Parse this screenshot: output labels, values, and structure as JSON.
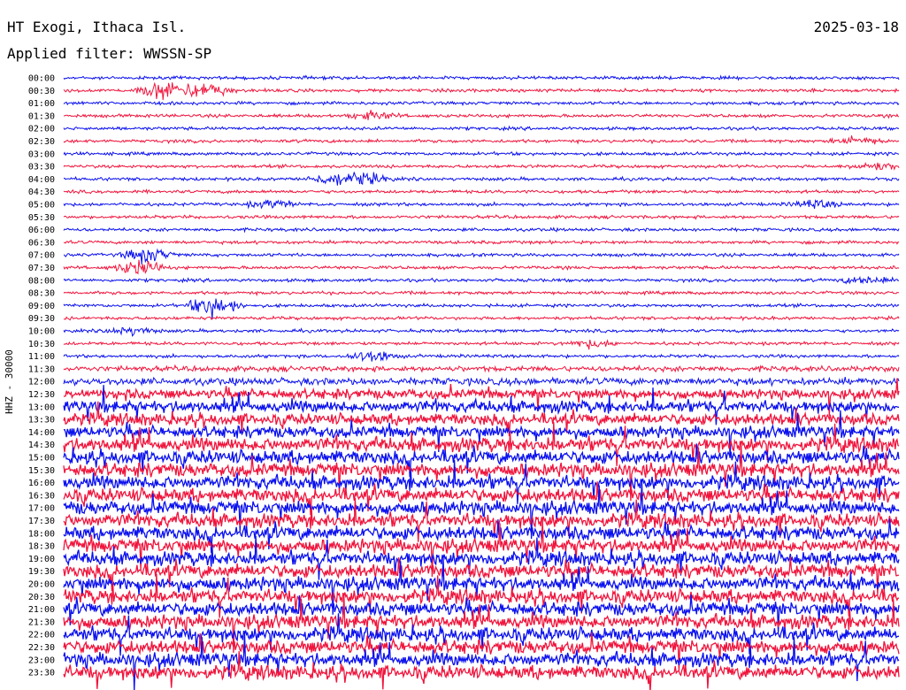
{
  "header": {
    "station": "HT Exogi, Ithaca Isl.",
    "date": "2025-03-18",
    "filter": "Applied filter: WWSSN-SP"
  },
  "colors": {
    "trace_a": "#0a10ee",
    "trace_b": "#f0143c",
    "text": "#000000",
    "background": "#ffffff"
  },
  "chart_data": {
    "type": "line",
    "ylabel": "HHZ - 30000",
    "ticks": [
      "00:00",
      "00:30",
      "01:00",
      "01:30",
      "02:00",
      "02:30",
      "03:00",
      "03:30",
      "04:00",
      "04:30",
      "05:00",
      "05:30",
      "06:00",
      "06:30",
      "07:00",
      "07:30",
      "08:00",
      "08:30",
      "09:00",
      "09:30",
      "10:00",
      "10:30",
      "11:00",
      "11:30",
      "12:00",
      "12:30",
      "13:00",
      "13:30",
      "14:00",
      "14:30",
      "15:00",
      "15:30",
      "16:00",
      "16:30",
      "17:00",
      "17:30",
      "18:00",
      "18:30",
      "19:00",
      "19:30",
      "20:00",
      "20:30",
      "21:00",
      "21:30",
      "22:00",
      "22:30",
      "23:00",
      "23:30"
    ],
    "row_minutes": 30,
    "color_cycle": [
      "blue",
      "red"
    ],
    "noise_level": [
      1,
      1,
      1,
      1,
      1,
      1,
      1,
      1,
      1,
      1,
      1,
      1,
      1,
      1,
      1,
      1,
      1,
      1,
      1,
      1,
      1,
      1,
      1,
      2,
      3,
      4,
      5,
      5,
      5,
      6,
      6,
      6,
      6,
      6,
      6,
      6,
      6,
      6,
      6,
      6,
      6,
      6,
      6,
      6,
      6,
      6,
      6,
      6
    ],
    "events": [
      {
        "row": 1,
        "pos": 0.12,
        "amp": 5
      },
      {
        "row": 1,
        "pos": 0.17,
        "amp": 4
      },
      {
        "row": 3,
        "pos": 0.37,
        "amp": 2
      },
      {
        "row": 8,
        "pos": 0.32,
        "amp": 3
      },
      {
        "row": 8,
        "pos": 0.36,
        "amp": 3
      },
      {
        "row": 10,
        "pos": 0.25,
        "amp": 2
      },
      {
        "row": 10,
        "pos": 0.9,
        "amp": 2
      },
      {
        "row": 14,
        "pos": 0.1,
        "amp": 4
      },
      {
        "row": 15,
        "pos": 0.09,
        "amp": 4
      },
      {
        "row": 16,
        "pos": 0.96,
        "amp": 2
      },
      {
        "row": 18,
        "pos": 0.18,
        "amp": 6
      },
      {
        "row": 20,
        "pos": 0.08,
        "amp": 2
      },
      {
        "row": 21,
        "pos": 0.63,
        "amp": 2
      },
      {
        "row": 22,
        "pos": 0.37,
        "amp": 3
      },
      {
        "row": 7,
        "pos": 0.97,
        "amp": 2
      },
      {
        "row": 5,
        "pos": 0.95,
        "amp": 2
      }
    ]
  }
}
